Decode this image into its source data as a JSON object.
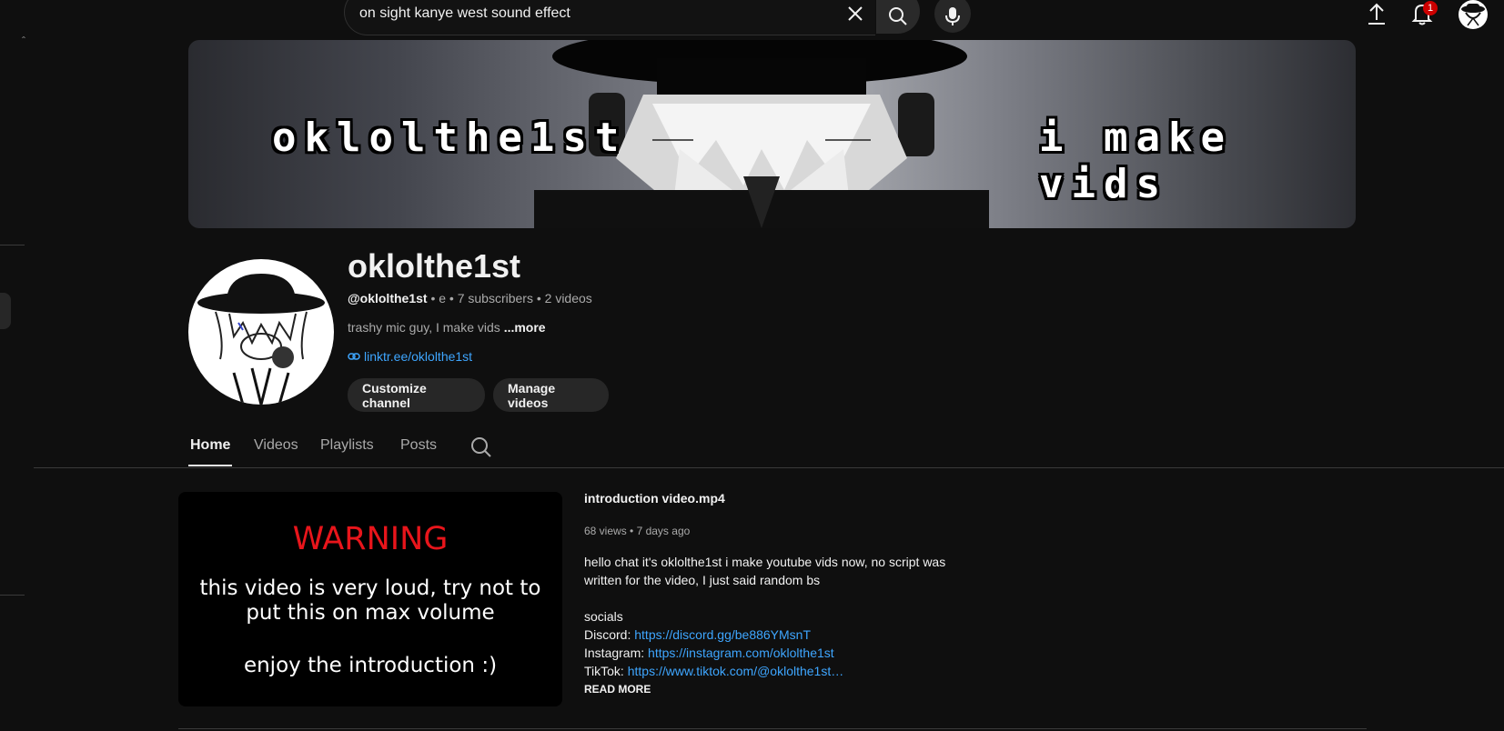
{
  "topbar": {
    "search_value": "on sight kanye west sound effect",
    "notification_count": "1"
  },
  "banner": {
    "title": "oklolthe1st",
    "tagline": "i make vids"
  },
  "channel": {
    "name": "oklolthe1st",
    "handle": "@oklolthe1st",
    "meta_rest": "• e • 7 subscribers • 2 videos",
    "description": "trashy mic guy, I make vids",
    "more_label": "...more",
    "link": "linktr.ee/oklolthe1st",
    "customize_label": "Customize channel",
    "manage_label": "Manage videos"
  },
  "tabs": [
    {
      "label": "Home"
    },
    {
      "label": "Videos"
    },
    {
      "label": "Playlists"
    },
    {
      "label": "Posts"
    }
  ],
  "featured": {
    "thumb_warning": "WARNING",
    "thumb_line1": "this video is very loud, try not to",
    "thumb_line2": "put this on max volume",
    "thumb_line3": "enjoy the introduction :)",
    "title": "introduction video.mp4",
    "views": "68 views",
    "age": "7 days ago",
    "desc_line1": "hello chat it's oklolthe1st i make youtube vids now, no script was",
    "desc_line2": "written for the video, I just said random bs",
    "socials_heading": "socials",
    "discord_label": "Discord:",
    "discord_url": "https://discord.gg/be886YMsnT",
    "instagram_label": "Instagram:",
    "instagram_url": "https://instagram.com/oklolthe1st",
    "tiktok_label": "TikTok:",
    "tiktok_url": "https://www.tiktok.com/@oklolthe1st…",
    "read_more": "READ MORE"
  },
  "colors": {
    "background": "#0f0f0f",
    "link": "#3ea6ff",
    "warning": "#e8151b",
    "badge": "#cc0000"
  }
}
